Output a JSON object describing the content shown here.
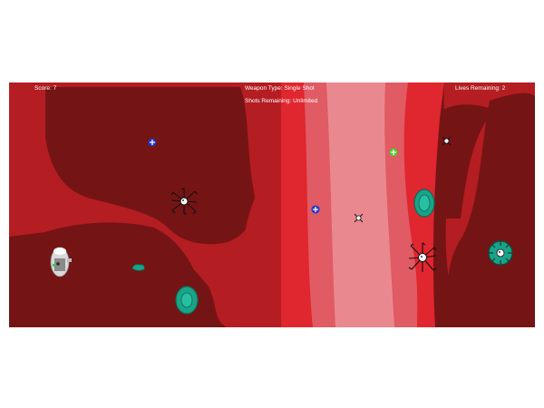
{
  "hud": {
    "score_label": "Score: 7",
    "weapon_label": "Weapon Type: Single Shot",
    "shots_label": "Shots Remaining: Unlimited",
    "lives_label": "Lives Remaining: 2"
  },
  "colors": {
    "outer_tissue": "#751414",
    "mid_tissue": "#b41d21",
    "vessel_wall": "#e0262e",
    "vessel_lumen": "#e05b63",
    "vessel_core": "#ea8890",
    "teal_cell": "#1aa389",
    "blue_powerup": "#2233cc",
    "green_powerup": "#4ecc2a"
  },
  "sprites": [
    {
      "name": "player-ship-icon"
    },
    {
      "name": "blue-plus-powerup-icon"
    },
    {
      "name": "green-plus-powerup-icon"
    },
    {
      "name": "blue-plus-powerup-icon"
    },
    {
      "name": "black-virus-enemy-icon"
    },
    {
      "name": "black-virus-enemy-icon"
    },
    {
      "name": "small-bacterium-enemy-icon"
    },
    {
      "name": "small-bacterium-enemy-icon"
    },
    {
      "name": "teal-cell-obstacle-icon"
    },
    {
      "name": "teal-cell-obstacle-icon"
    },
    {
      "name": "teal-cell-obstacle-icon"
    },
    {
      "name": "teal-spiked-virus-enemy-icon"
    }
  ]
}
